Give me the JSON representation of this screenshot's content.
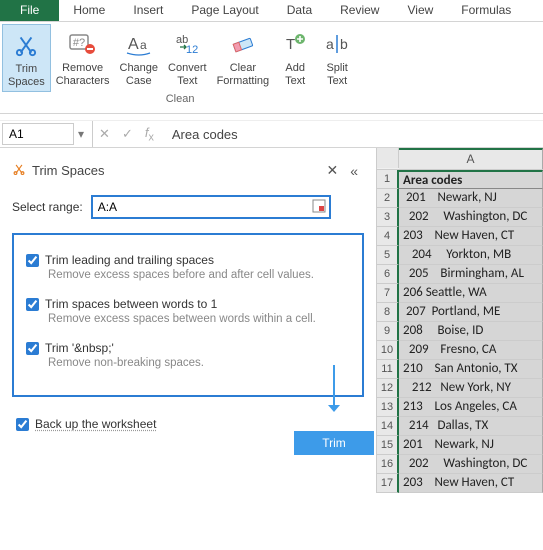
{
  "tabs": {
    "file": "File",
    "home": "Home",
    "insert": "Insert",
    "pagelayout": "Page Layout",
    "data": "Data",
    "review": "Review",
    "view": "View",
    "formulas": "Formulas"
  },
  "ribbon": {
    "trim": "Trim\nSpaces",
    "remove": "Remove\nCharacters",
    "case": "Change\nCase",
    "convert": "Convert\nText",
    "clearfmt": "Clear\nFormatting",
    "add": "Add\nText",
    "split": "Split\nText",
    "group": "Clean"
  },
  "namebox": "A1",
  "formula": "Area codes",
  "pane": {
    "title": "Trim Spaces",
    "select_label": "Select range:",
    "range": "A:A",
    "opt1": {
      "label": "Trim leading and trailing spaces",
      "desc": "Remove excess spaces before and after cell values."
    },
    "opt2": {
      "label": "Trim spaces between words to 1",
      "desc": "Remove excess spaces between words within a cell."
    },
    "opt3": {
      "label": "Trim '&nbsp;'",
      "desc": "Remove non-breaking spaces."
    },
    "backup": "Back up the worksheet",
    "trim_btn": "Trim"
  },
  "grid": {
    "col": "A",
    "rows": [
      "Area codes",
      " 201    Newark, NJ",
      "  202     Washington, DC",
      "203    New Haven, CT",
      "   204     Yorkton, MB",
      "  205    Birmingham, AL",
      "206 Seattle, WA",
      " 207  Portland, ME",
      "208     Boise, ID",
      "  209    Fresno, CA",
      "210    San Antonio, TX",
      "   212   New York, NY",
      "213    Los Angeles, CA",
      "  214   Dallas, TX",
      "201    Newark, NJ",
      "  202     Washington, DC",
      "203    New Haven, CT"
    ]
  }
}
